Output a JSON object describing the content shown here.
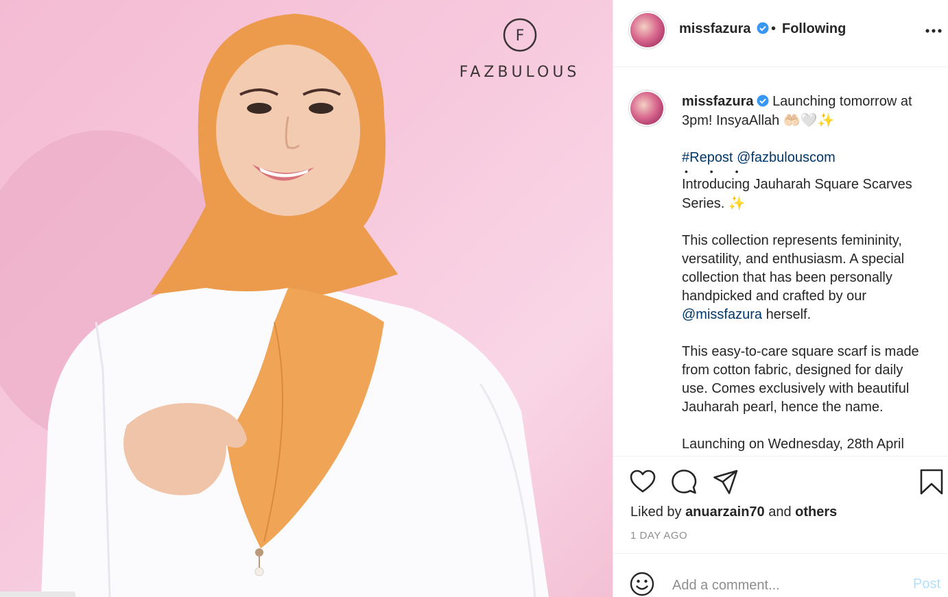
{
  "image": {
    "brand_letter": "F",
    "brand_name": "FAZBULOUS"
  },
  "header": {
    "username": "missfazura",
    "separator": "•",
    "follow_state": "Following"
  },
  "caption": {
    "username": "missfazura",
    "text_line1": "Launching tomorrow at 3pm! InsyaAllah",
    "emojis_line1": "🤲🏻🤍✨",
    "repost_tag": "#Repost",
    "repost_mention": "@fazbulouscom",
    "dots": "• • •",
    "para1": "Introducing Jauharah Square Scarves Series.",
    "para1_emoji": "✨",
    "para2": "This collection represents femininity, versatility, and enthusiasm. A special collection that has been personally handpicked and crafted by our",
    "para2_mention": "@missfazura",
    "para2_end": "herself.",
    "para3": "This easy-to-care square scarf is made from cotton fabric, designed for daily use. Comes exclusively with beautiful Jauharah pearl, hence the name.",
    "para4": "Launching on Wednesday, 28th April"
  },
  "actions": {
    "liked_by_prefix": "Liked by",
    "liked_by_user": "anuarzain70",
    "liked_by_and": "and",
    "liked_by_others": "others",
    "timestamp": "1 DAY AGO"
  },
  "comment": {
    "placeholder": "Add a comment...",
    "post_label": "Post"
  },
  "colors": {
    "link": "#00376b",
    "verified": "#3897f0",
    "post_disabled": "#b2dffc",
    "muted": "#8e8e8e",
    "backdrop_pink": "#f7c9dd",
    "scarf_orange": "#ee9e4e"
  }
}
